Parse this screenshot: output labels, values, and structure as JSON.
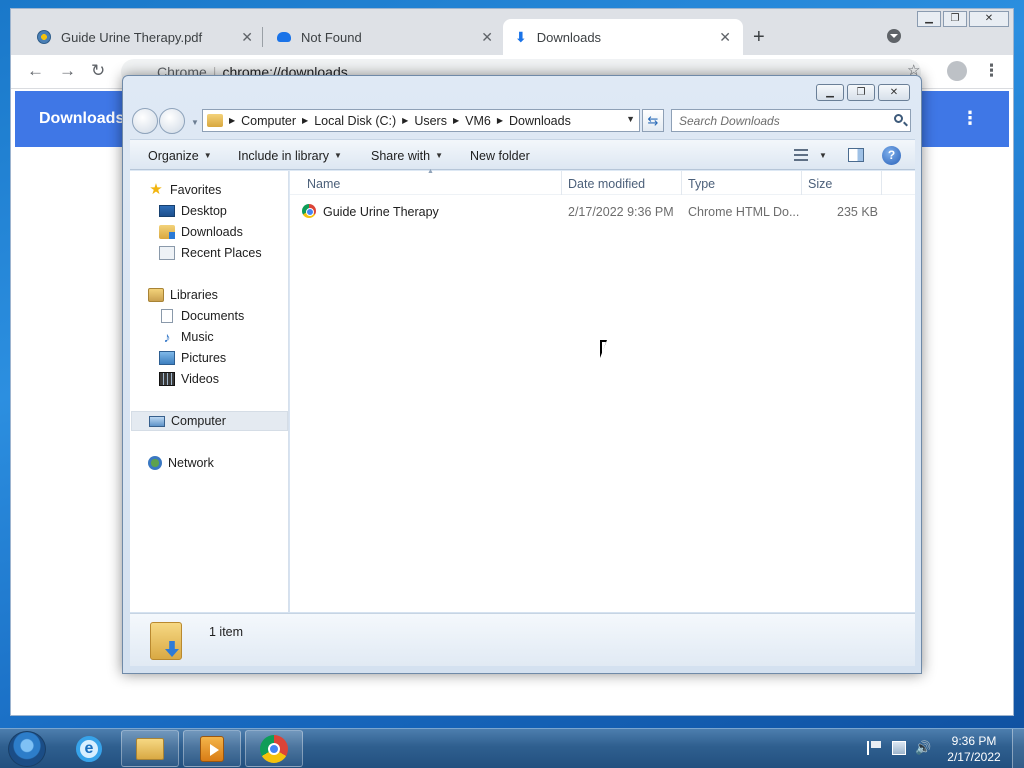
{
  "chrome": {
    "tabs": [
      {
        "title": "Guide Urine Therapy.pdf",
        "icon": "pdf-favicon-icon",
        "active": false
      },
      {
        "title": "Not Found",
        "icon": "cloud-favicon-icon",
        "active": false
      },
      {
        "title": "Downloads",
        "icon": "download-favicon-icon",
        "active": true
      }
    ],
    "tab_close_glyph": "✕",
    "new_tab_glyph": "+",
    "omnibox": {
      "site_label": "Chrome",
      "url": "chrome://downloads"
    },
    "page_title": "Downloads",
    "menu_glyph": "⋮",
    "accent_color": "#3f77e6"
  },
  "explorer": {
    "breadcrumb": [
      "Computer",
      "Local Disk (C:)",
      "Users",
      "VM6",
      "Downloads"
    ],
    "search_placeholder": "Search Downloads",
    "commands": {
      "organize": "Organize",
      "include_in_library": "Include in library",
      "share_with": "Share with",
      "new_folder": "New folder"
    },
    "help_glyph": "?",
    "nav": {
      "favorites": {
        "label": "Favorites",
        "items": [
          "Desktop",
          "Downloads",
          "Recent Places"
        ]
      },
      "libraries": {
        "label": "Libraries",
        "items": [
          "Documents",
          "Music",
          "Pictures",
          "Videos"
        ]
      },
      "computer": "Computer",
      "network": "Network"
    },
    "columns": [
      "Name",
      "Date modified",
      "Type",
      "Size"
    ],
    "files": [
      {
        "name": "Guide Urine Therapy",
        "date_modified": "2/17/2022 9:36 PM",
        "type": "Chrome HTML Do...",
        "size": "235 KB",
        "icon": "chrome-html-file-icon"
      }
    ],
    "status": {
      "item_count": "1 item"
    }
  },
  "taskbar": {
    "pinned": [
      "internet-explorer-icon",
      "windows-explorer-icon",
      "media-player-icon",
      "chrome-icon"
    ],
    "clock": {
      "time": "9:36 PM",
      "date": "2/17/2022"
    }
  }
}
